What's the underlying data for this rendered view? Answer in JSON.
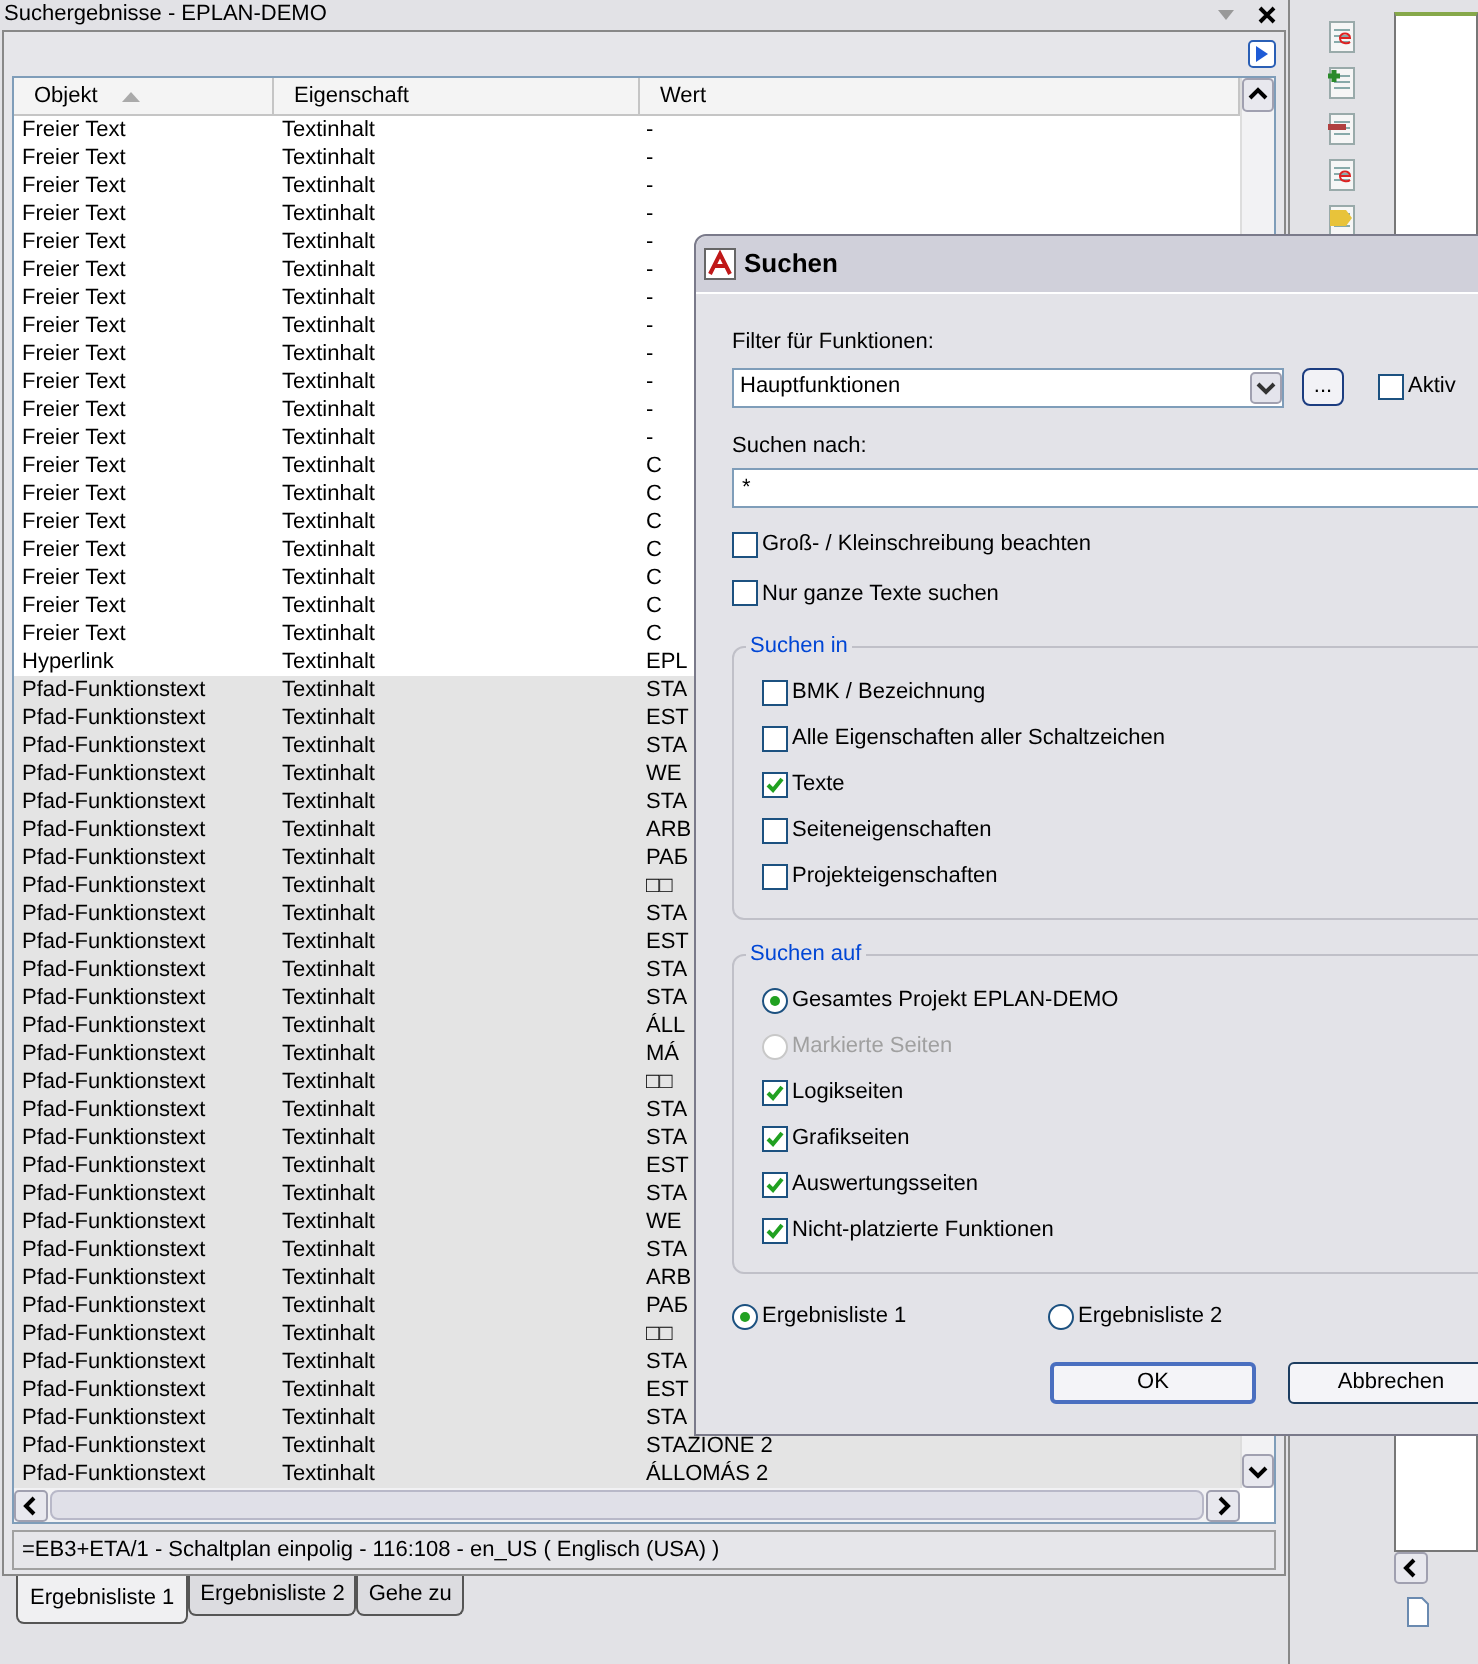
{
  "panel": {
    "title": "Suchergebnisse - EPLAN-DEMO",
    "columns": [
      {
        "label": "Objekt",
        "sorted": true
      },
      {
        "label": "Eigenschaft",
        "sorted": false
      },
      {
        "label": "Wert",
        "sorted": false
      }
    ],
    "rows": [
      {
        "objekt": "Freier Text",
        "eigenschaft": "Textinhalt",
        "wert": "-",
        "selected": false
      },
      {
        "objekt": "Freier Text",
        "eigenschaft": "Textinhalt",
        "wert": "-",
        "selected": false
      },
      {
        "objekt": "Freier Text",
        "eigenschaft": "Textinhalt",
        "wert": "-",
        "selected": false
      },
      {
        "objekt": "Freier Text",
        "eigenschaft": "Textinhalt",
        "wert": "-",
        "selected": false
      },
      {
        "objekt": "Freier Text",
        "eigenschaft": "Textinhalt",
        "wert": "-",
        "selected": false
      },
      {
        "objekt": "Freier Text",
        "eigenschaft": "Textinhalt",
        "wert": "-",
        "selected": false
      },
      {
        "objekt": "Freier Text",
        "eigenschaft": "Textinhalt",
        "wert": "-",
        "selected": false
      },
      {
        "objekt": "Freier Text",
        "eigenschaft": "Textinhalt",
        "wert": "-",
        "selected": false
      },
      {
        "objekt": "Freier Text",
        "eigenschaft": "Textinhalt",
        "wert": "-",
        "selected": false
      },
      {
        "objekt": "Freier Text",
        "eigenschaft": "Textinhalt",
        "wert": "-",
        "selected": false
      },
      {
        "objekt": "Freier Text",
        "eigenschaft": "Textinhalt",
        "wert": "-",
        "selected": false
      },
      {
        "objekt": "Freier Text",
        "eigenschaft": "Textinhalt",
        "wert": "-",
        "selected": false
      },
      {
        "objekt": "Freier Text",
        "eigenschaft": "Textinhalt",
        "wert": "C",
        "selected": false
      },
      {
        "objekt": "Freier Text",
        "eigenschaft": "Textinhalt",
        "wert": "C",
        "selected": false
      },
      {
        "objekt": "Freier Text",
        "eigenschaft": "Textinhalt",
        "wert": "C",
        "selected": false
      },
      {
        "objekt": "Freier Text",
        "eigenschaft": "Textinhalt",
        "wert": "C",
        "selected": false
      },
      {
        "objekt": "Freier Text",
        "eigenschaft": "Textinhalt",
        "wert": "C",
        "selected": false
      },
      {
        "objekt": "Freier Text",
        "eigenschaft": "Textinhalt",
        "wert": "C",
        "selected": false
      },
      {
        "objekt": "Freier Text",
        "eigenschaft": "Textinhalt",
        "wert": "C",
        "selected": false
      },
      {
        "objekt": "Hyperlink",
        "eigenschaft": "Textinhalt",
        "wert": "EPL",
        "selected": false
      },
      {
        "objekt": "Pfad-Funktionstext",
        "eigenschaft": "Textinhalt",
        "wert": "STA",
        "selected": true
      },
      {
        "objekt": "Pfad-Funktionstext",
        "eigenschaft": "Textinhalt",
        "wert": "EST",
        "selected": true
      },
      {
        "objekt": "Pfad-Funktionstext",
        "eigenschaft": "Textinhalt",
        "wert": "STA",
        "selected": true
      },
      {
        "objekt": "Pfad-Funktionstext",
        "eigenschaft": "Textinhalt",
        "wert": "WE",
        "selected": true
      },
      {
        "objekt": "Pfad-Funktionstext",
        "eigenschaft": "Textinhalt",
        "wert": "STA",
        "selected": true
      },
      {
        "objekt": "Pfad-Funktionstext",
        "eigenschaft": "Textinhalt",
        "wert": "ARB",
        "selected": true
      },
      {
        "objekt": "Pfad-Funktionstext",
        "eigenschaft": "Textinhalt",
        "wert": "PAБ",
        "selected": true
      },
      {
        "objekt": "Pfad-Funktionstext",
        "eigenschaft": "Textinhalt",
        "wert": "□□",
        "selected": true
      },
      {
        "objekt": "Pfad-Funktionstext",
        "eigenschaft": "Textinhalt",
        "wert": "STA",
        "selected": true
      },
      {
        "objekt": "Pfad-Funktionstext",
        "eigenschaft": "Textinhalt",
        "wert": "EST",
        "selected": true
      },
      {
        "objekt": "Pfad-Funktionstext",
        "eigenschaft": "Textinhalt",
        "wert": "STA",
        "selected": true
      },
      {
        "objekt": "Pfad-Funktionstext",
        "eigenschaft": "Textinhalt",
        "wert": "STA",
        "selected": true
      },
      {
        "objekt": "Pfad-Funktionstext",
        "eigenschaft": "Textinhalt",
        "wert": "ÁLL",
        "selected": true
      },
      {
        "objekt": "Pfad-Funktionstext",
        "eigenschaft": "Textinhalt",
        "wert": "MÁ",
        "selected": true
      },
      {
        "objekt": "Pfad-Funktionstext",
        "eigenschaft": "Textinhalt",
        "wert": "□□",
        "selected": true
      },
      {
        "objekt": "Pfad-Funktionstext",
        "eigenschaft": "Textinhalt",
        "wert": "STA",
        "selected": true
      },
      {
        "objekt": "Pfad-Funktionstext",
        "eigenschaft": "Textinhalt",
        "wert": "STA",
        "selected": true
      },
      {
        "objekt": "Pfad-Funktionstext",
        "eigenschaft": "Textinhalt",
        "wert": "EST",
        "selected": true
      },
      {
        "objekt": "Pfad-Funktionstext",
        "eigenschaft": "Textinhalt",
        "wert": "STA",
        "selected": true
      },
      {
        "objekt": "Pfad-Funktionstext",
        "eigenschaft": "Textinhalt",
        "wert": "WE",
        "selected": true
      },
      {
        "objekt": "Pfad-Funktionstext",
        "eigenschaft": "Textinhalt",
        "wert": "STA",
        "selected": true
      },
      {
        "objekt": "Pfad-Funktionstext",
        "eigenschaft": "Textinhalt",
        "wert": "ARB",
        "selected": true
      },
      {
        "objekt": "Pfad-Funktionstext",
        "eigenschaft": "Textinhalt",
        "wert": "PAБ",
        "selected": true
      },
      {
        "objekt": "Pfad-Funktionstext",
        "eigenschaft": "Textinhalt",
        "wert": "□□",
        "selected": true
      },
      {
        "objekt": "Pfad-Funktionstext",
        "eigenschaft": "Textinhalt",
        "wert": "STA",
        "selected": true
      },
      {
        "objekt": "Pfad-Funktionstext",
        "eigenschaft": "Textinhalt",
        "wert": "EST",
        "selected": true
      },
      {
        "objekt": "Pfad-Funktionstext",
        "eigenschaft": "Textinhalt",
        "wert": "STA",
        "selected": true
      },
      {
        "objekt": "Pfad-Funktionstext",
        "eigenschaft": "Textinhalt",
        "wert": "STAZIONE 2",
        "selected": true
      },
      {
        "objekt": "Pfad-Funktionstext",
        "eigenschaft": "Textinhalt",
        "wert": "ÁLLOMÁS 2",
        "selected": true
      }
    ],
    "status": "=EB3+ETA/1 - Schaltplan einpolig - 116:108 - en_US ( Englisch (USA) )",
    "tabs": [
      {
        "label": "Ergebnisliste 1",
        "selected": true
      },
      {
        "label": "Ergebnisliste 2",
        "selected": false
      },
      {
        "label": "Gehe zu",
        "selected": false
      }
    ]
  },
  "dialog": {
    "title": "Suchen",
    "filter_label": "Filter für Funktionen:",
    "filter_value": "Hauptfunktionen",
    "more_button": "...",
    "aktiv": {
      "label": "Aktiv",
      "checked": false
    },
    "search_label": "Suchen nach:",
    "search_value": "*",
    "options": [
      {
        "label": "Groß- / Kleinschreibung beachten",
        "checked": false
      },
      {
        "label": "Nur ganze Texte suchen",
        "checked": false
      }
    ],
    "groups": [
      {
        "title": "Suchen in",
        "items": [
          {
            "kind": "checkbox",
            "label": "BMK / Bezeichnung",
            "checked": false,
            "disabled": false
          },
          {
            "kind": "checkbox",
            "label": "Alle Eigenschaften aller Schaltzeichen",
            "checked": false,
            "disabled": false
          },
          {
            "kind": "checkbox",
            "label": "Texte",
            "checked": true,
            "disabled": false
          },
          {
            "kind": "checkbox",
            "label": "Seiteneigenschaften",
            "checked": false,
            "disabled": false
          },
          {
            "kind": "checkbox",
            "label": "Projekteigenschaften",
            "checked": false,
            "disabled": false
          }
        ]
      },
      {
        "title": "Suchen auf",
        "items": [
          {
            "kind": "radio",
            "label": "Gesamtes Projekt EPLAN-DEMO",
            "selected": true,
            "disabled": false
          },
          {
            "kind": "radio",
            "label": "Markierte Seiten",
            "selected": false,
            "disabled": true
          },
          {
            "kind": "checkbox",
            "label": "Logikseiten",
            "checked": true,
            "disabled": false
          },
          {
            "kind": "checkbox",
            "label": "Grafikseiten",
            "checked": true,
            "disabled": false
          },
          {
            "kind": "checkbox",
            "label": "Auswertungsseiten",
            "checked": true,
            "disabled": false
          },
          {
            "kind": "checkbox",
            "label": "Nicht-platzierte Funktionen",
            "checked": true,
            "disabled": false
          }
        ]
      }
    ],
    "result_lists": [
      {
        "label": "Ergebnisliste 1",
        "selected": true
      },
      {
        "label": "Ergebnisliste 2",
        "selected": false
      }
    ],
    "buttons": [
      {
        "label": "OK",
        "default": true
      },
      {
        "label": "Abbrechen",
        "default": false
      }
    ]
  }
}
